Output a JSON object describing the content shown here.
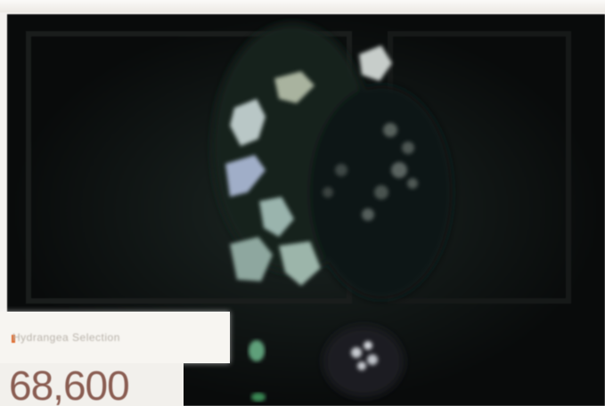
{
  "caption": {
    "text": "Hydrangea Selection"
  },
  "price": {
    "value": "68,600"
  },
  "colors": {
    "background": "#0b0d0d",
    "caption_card": "#f7f5f1",
    "accent": "#e36a2c",
    "price_text": "#8a5d52",
    "leaf_pale": "#9cb3ad",
    "leaf_blue": "#8ea2c4"
  },
  "icons": {
    "caption_marker": "orange-bar"
  }
}
